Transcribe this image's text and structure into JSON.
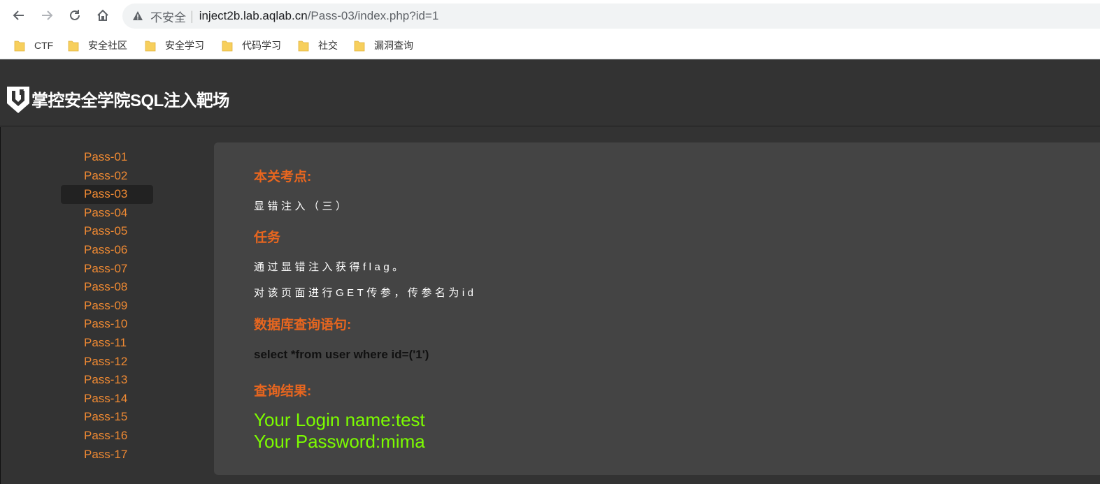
{
  "browser": {
    "insecure_label": "不安全",
    "separator": "|",
    "url_host": "inject2b.lab.aqlab.cn",
    "url_path": "/Pass-03/index.php?id=1"
  },
  "bookmarks": [
    {
      "label": "CTF"
    },
    {
      "label": "安全社区"
    },
    {
      "label": "安全学习"
    },
    {
      "label": "代码学习"
    },
    {
      "label": "社交"
    },
    {
      "label": "漏洞查询"
    }
  ],
  "header": {
    "site_title": "掌控安全学院SQL注入靶场"
  },
  "sidebar": {
    "items": [
      {
        "label": "Pass-01"
      },
      {
        "label": "Pass-02"
      },
      {
        "label": "Pass-03"
      },
      {
        "label": "Pass-04"
      },
      {
        "label": "Pass-05"
      },
      {
        "label": "Pass-06"
      },
      {
        "label": "Pass-07"
      },
      {
        "label": "Pass-08"
      },
      {
        "label": "Pass-09"
      },
      {
        "label": "Pass-10"
      },
      {
        "label": "Pass-11"
      },
      {
        "label": "Pass-12"
      },
      {
        "label": "Pass-13"
      },
      {
        "label": "Pass-14"
      },
      {
        "label": "Pass-15"
      },
      {
        "label": "Pass-16"
      },
      {
        "label": "Pass-17"
      }
    ],
    "active": "Pass-03"
  },
  "main": {
    "focus_title": "本关考点:",
    "focus_text": "显错注入（三）",
    "task_title": "任务",
    "task_line1": "通过显错注入获得flag。",
    "task_line2": "对该页面进行GET传参，传参名为id",
    "query_title": "数据库查询语句:",
    "query_text": "select *from user where id=('1')",
    "result_title": "查询结果:",
    "result_line1": "Your Login name:test",
    "result_line2": "Your Password:mima"
  },
  "colors": {
    "accent_orange": "#e8661f",
    "nav_orange": "#f08a33",
    "result_green": "#7cfc00",
    "bg_dark": "#333333",
    "panel_bg": "#444444"
  }
}
